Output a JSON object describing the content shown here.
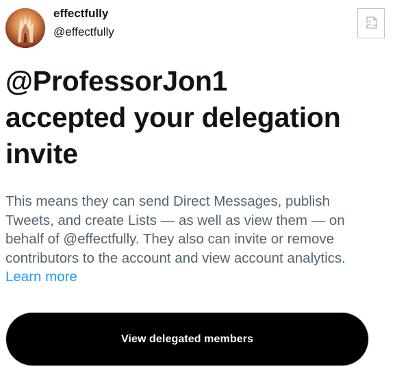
{
  "account": {
    "display_name": "effectfully",
    "handle": "@effectfully",
    "avatar_icon": "profile-avatar-image"
  },
  "header": {
    "broken_image_icon": "broken-image-icon"
  },
  "headline": {
    "lines": [
      "@ProfessorJon1",
      "accepted your delegation",
      "invite"
    ]
  },
  "description": {
    "lines": [
      "This means they can send Direct Messages, publish",
      "Tweets, and create Lists — as well as view them — on",
      "behalf of @effectfully. They also can invite or remove",
      "contributors to the account and view account analytics."
    ],
    "learn_more": "Learn more"
  },
  "cta": {
    "label": "View delegated members"
  },
  "colors": {
    "text_primary": "#0f1419",
    "text_secondary": "#536471",
    "link": "#1d9bf0",
    "button_bg": "#000000",
    "button_text": "#ffffff"
  }
}
